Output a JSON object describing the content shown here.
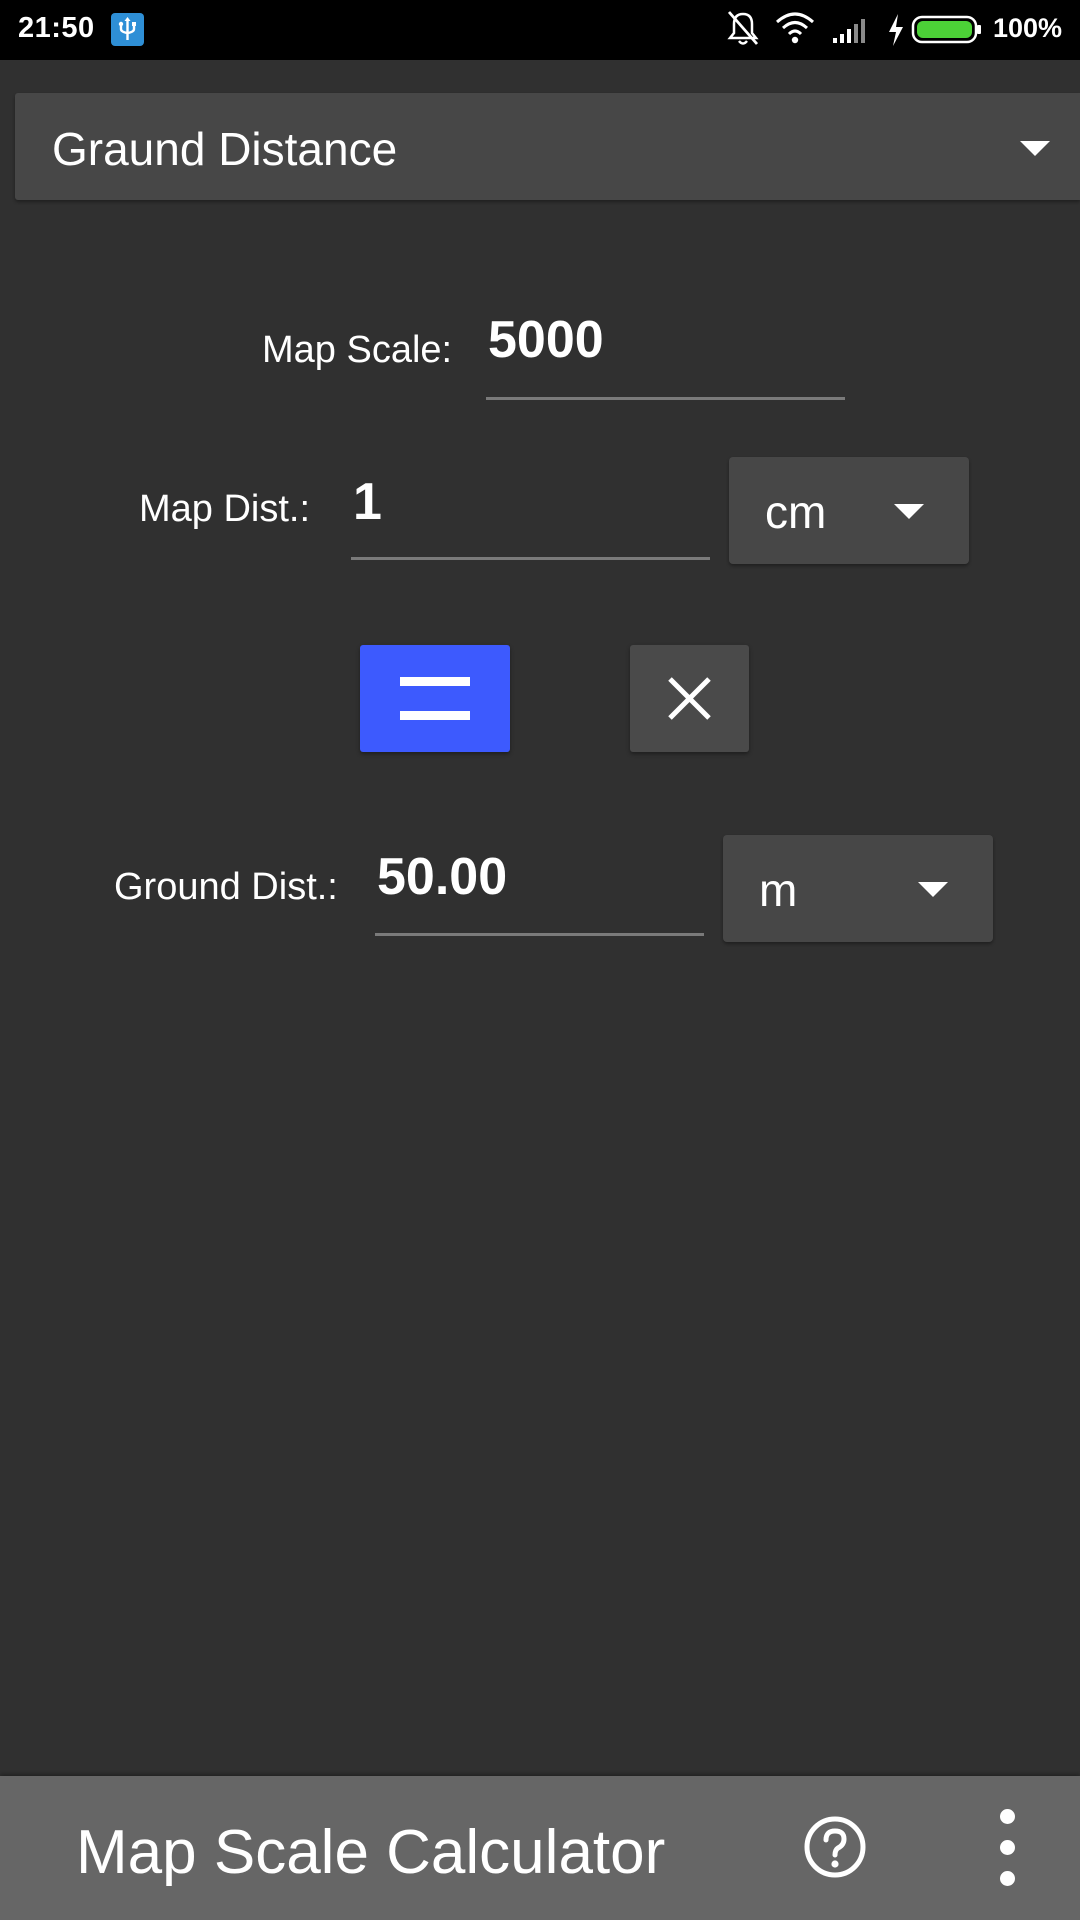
{
  "status_bar": {
    "time": "21:50",
    "battery_percent": "100%",
    "icons": [
      "usb-icon",
      "alarm-off-icon",
      "wifi-icon",
      "signal-icon",
      "charging-icon",
      "battery-icon"
    ]
  },
  "mode": {
    "selected": "Graund Distance"
  },
  "map_scale": {
    "label": "Map Scale:",
    "value": "5000"
  },
  "map_dist": {
    "label": "Map Dist.:",
    "value": "1",
    "unit": "cm"
  },
  "actions": {
    "calculate_icon": "equals-icon",
    "clear_icon": "close-icon"
  },
  "ground_dist": {
    "label": "Ground Dist.:",
    "value": "50.00",
    "unit": "m"
  },
  "app_bar": {
    "title": "Map Scale Calculator",
    "help_icon": "help-icon",
    "menu_icon": "more-vertical-icon"
  },
  "colors": {
    "background": "#303030",
    "accent": "#3d5afe",
    "battery": "#4cd137",
    "app_bar": "#666666"
  }
}
